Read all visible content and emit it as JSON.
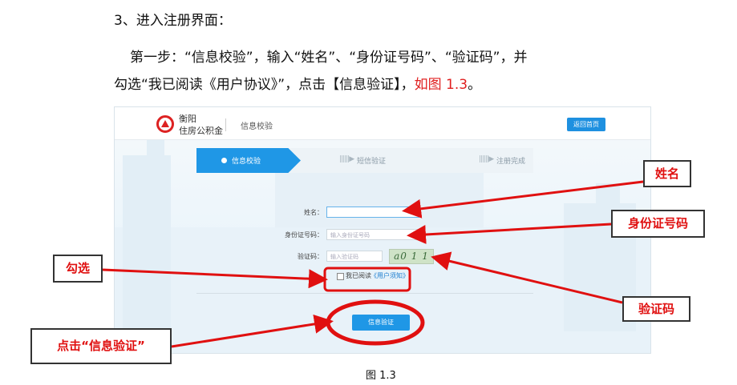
{
  "document": {
    "heading": "3、进入注册界面：",
    "para_line1": "第一步：“信息校验”，输入“姓名”、“身份证号码”、“验证码”，并",
    "para_line2_pre": "勾选“我已阅读《用户协议》”，点击【信息验证】，",
    "para_line2_ref": "如图 1.3",
    "para_line2_post": "。",
    "caption": "图 1.3"
  },
  "screenshot": {
    "logo_line1": "衡阳",
    "logo_line2": "住房公积金",
    "header_title": "信息校验",
    "home_button": "返回首页",
    "steps": {
      "step1": "信息校验",
      "step2": "短信验证",
      "step3": "注册完成",
      "arrow": "||||||▶"
    },
    "form": {
      "name_label": "姓名：",
      "id_label": "身份证号码：",
      "id_placeholder": "输入身份证号码",
      "code_label": "验证码：",
      "code_placeholder": "输入验证码",
      "captcha_text": "a0 1 1",
      "agree_text": "我已阅读",
      "agree_link": "《用户须知》",
      "verify_button": "信息验证"
    }
  },
  "annotations": {
    "name": "姓名",
    "id_number": "身份证号码",
    "tick": "勾选",
    "captcha": "验证码",
    "click_verify": "点击“信息验证”"
  },
  "colors": {
    "annotation_red": "#e01010",
    "primary_blue": "#1f97e6"
  }
}
